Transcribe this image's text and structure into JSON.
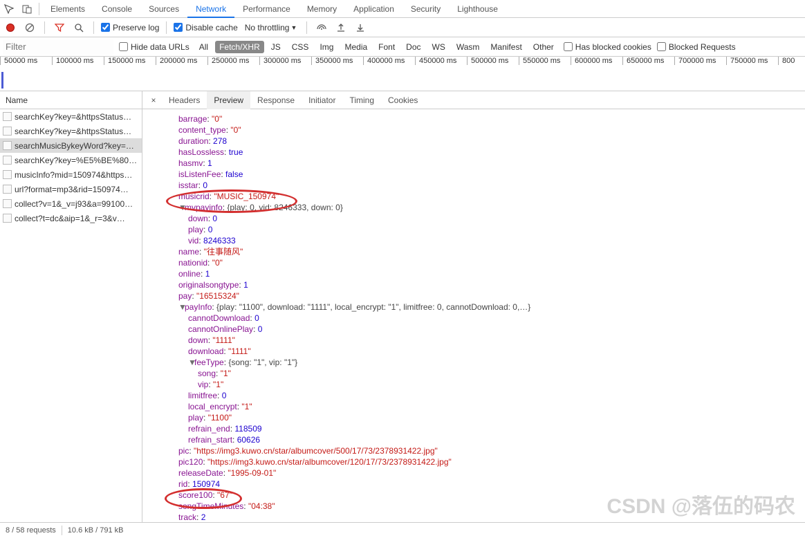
{
  "tabs": [
    "Elements",
    "Console",
    "Sources",
    "Network",
    "Performance",
    "Memory",
    "Application",
    "Security",
    "Lighthouse"
  ],
  "active_tab": "Network",
  "toolbar": {
    "preserve_log": "Preserve log",
    "disable_cache": "Disable cache",
    "throttling": "No throttling"
  },
  "filter": {
    "placeholder": "Filter",
    "hide_data_urls": "Hide data URLs",
    "blocked_cookies": "Has blocked cookies",
    "blocked_requests": "Blocked Requests",
    "types": [
      "All",
      "Fetch/XHR",
      "JS",
      "CSS",
      "Img",
      "Media",
      "Font",
      "Doc",
      "WS",
      "Wasm",
      "Manifest",
      "Other"
    ],
    "active_type": "Fetch/XHR"
  },
  "timeline_ticks": [
    "50000 ms",
    "100000 ms",
    "150000 ms",
    "200000 ms",
    "250000 ms",
    "300000 ms",
    "350000 ms",
    "400000 ms",
    "450000 ms",
    "500000 ms",
    "550000 ms",
    "600000 ms",
    "650000 ms",
    "700000 ms",
    "750000 ms",
    "800"
  ],
  "left_header": "Name",
  "requests": [
    "searchKey?key=&httpsStatus…",
    "searchKey?key=&httpsStatus…",
    "searchMusicBykeyWord?key=…",
    "searchKey?key=%E5%BE%80…",
    "musicInfo?mid=150974&https…",
    "url?format=mp3&rid=150974…",
    "collect?v=1&_v=j93&a=99100…",
    "collect?t=dc&aip=1&_r=3&v…"
  ],
  "selected_request": 2,
  "right_tabs": [
    "Headers",
    "Preview",
    "Response",
    "Initiator",
    "Timing",
    "Cookies"
  ],
  "active_right": "Preview",
  "preview": {
    "barrage": "\"0\"",
    "content_type": "\"0\"",
    "duration": "278",
    "hasLossless": "true",
    "hasmv": "1",
    "isListenFee": "false",
    "musicrid": "\"MUSIC_150974\"",
    "mvpayinfo_summary": "{play: 0, vid: 8246333, down: 0}",
    "mvpayinfo": {
      "down": "0",
      "play": "0",
      "vid": "8246333"
    },
    "name": "\"往事随风\"",
    "nationid": "\"0\"",
    "online": "1",
    "originalsongtype": "1",
    "pay": "\"16515324\"",
    "payInfo_summary": "{play: \"1100\", download: \"1111\", local_encrypt: \"1\", limitfree: 0, cannotDownload: 0,…}",
    "payInfo": {
      "cannotDownload": "0",
      "cannotOnlinePlay": "0",
      "down": "\"1111\"",
      "download": "\"1111\"",
      "feeType_summary": "{song: \"1\", vip: \"1\"}",
      "song": "\"1\"",
      "vip": "\"1\"",
      "limitfree": "0",
      "local_encrypt": "\"1\"",
      "play": "\"1100\"",
      "refrain_end": "118509",
      "refrain_start": "60626"
    },
    "pic": "\"https://img3.kuwo.cn/star/albumcover/500/17/73/2378931422.jpg\"",
    "pic120": "\"https://img3.kuwo.cn/star/albumcover/120/17/73/2378931422.jpg\"",
    "releaseDate": "\"1995-09-01\"",
    "rid": "150974",
    "score100": "\"67\"",
    "songTimeMinutes": "\"04:38\"",
    "track": "2"
  },
  "status": {
    "requests": "8 / 58 requests",
    "size": "10.6 kB / 791 kB"
  },
  "watermark": "CSDN @落伍的码农"
}
